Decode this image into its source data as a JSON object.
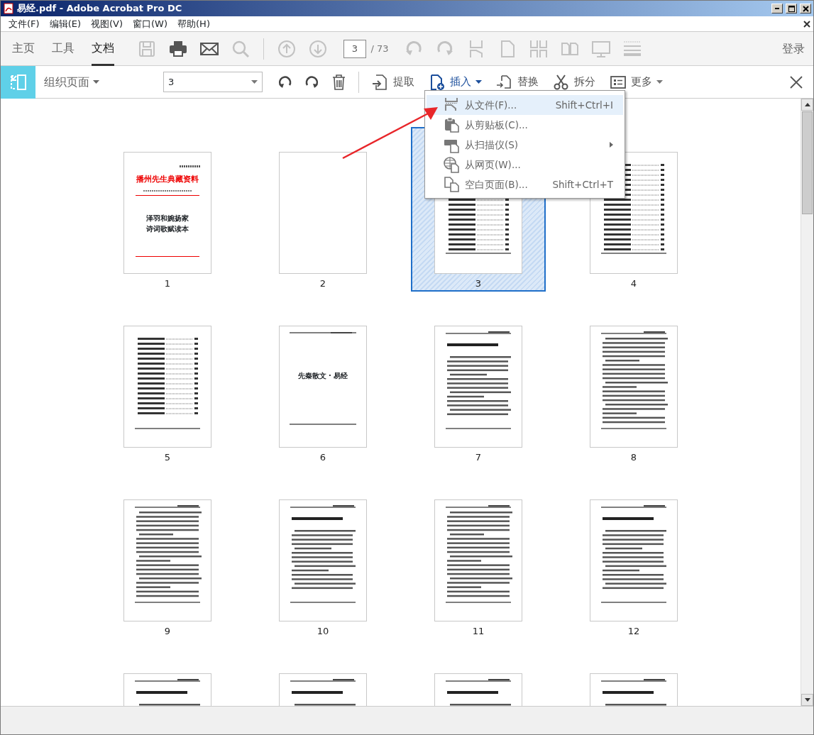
{
  "window": {
    "title": "易经.pdf - Adobe Acrobat Pro DC"
  },
  "menu_bar": [
    "文件(F)",
    "编辑(E)",
    "视图(V)",
    "窗口(W)",
    "帮助(H)"
  ],
  "nav_tabs": [
    {
      "label": "主页",
      "selected": false
    },
    {
      "label": "工具",
      "selected": false
    },
    {
      "label": "文档",
      "selected": true
    }
  ],
  "toolbar": {
    "tools": [
      {
        "kind": "save",
        "disabled": true
      },
      {
        "kind": "print",
        "disabled": false
      },
      {
        "kind": "mail",
        "disabled": false
      },
      {
        "kind": "search",
        "disabled": true
      },
      {
        "kind": "sep"
      },
      {
        "kind": "up",
        "disabled": true
      },
      {
        "kind": "down",
        "disabled": true
      },
      {
        "kind": "page"
      },
      {
        "kind": "undo",
        "disabled": true
      },
      {
        "kind": "redo",
        "disabled": true
      },
      {
        "kind": "crop",
        "disabled": true
      },
      {
        "kind": "doc",
        "disabled": true
      },
      {
        "kind": "cols",
        "disabled": true
      },
      {
        "kind": "book",
        "disabled": true
      },
      {
        "kind": "screen",
        "disabled": true
      },
      {
        "kind": "lines",
        "disabled": true
      }
    ],
    "page_number": "3",
    "page_total": "/ 73",
    "login": "登录"
  },
  "organize_bar": {
    "title": "组织页面",
    "page_range": "3",
    "actions": [
      {
        "kind": "extract",
        "label": "提取",
        "selected": false
      },
      {
        "kind": "insert",
        "label": "插入",
        "selected": true
      },
      {
        "kind": "replace",
        "label": "替换",
        "selected": false
      },
      {
        "kind": "split",
        "label": "拆分",
        "selected": false
      },
      {
        "kind": "more",
        "label": "更多",
        "selected": false
      }
    ]
  },
  "insert_menu": [
    {
      "kind": "file",
      "label": "从文件(F)...",
      "shortcut": "Shift+Ctrl+I",
      "selected": true,
      "submenu": false
    },
    {
      "kind": "clipboard",
      "label": "从剪贴板(C)...",
      "selected": false,
      "submenu": false
    },
    {
      "kind": "scanner",
      "label": "从扫描仪(S)",
      "selected": false,
      "submenu": true
    },
    {
      "kind": "web",
      "label": "从网页(W)...",
      "selected": false,
      "submenu": false
    },
    {
      "kind": "blank",
      "label": "空白页面(B)...",
      "shortcut": "Shift+Ctrl+T",
      "selected": false,
      "submenu": false
    }
  ],
  "pages": [
    {
      "kind": "cover",
      "label": "1",
      "selected": false,
      "title": "播州先生典藏资料",
      "lines": [
        "泽羽和婉扬家",
        "诗词歌赋读本"
      ]
    },
    {
      "kind": "blank",
      "label": "2",
      "selected": false
    },
    {
      "kind": "toc",
      "label": "3",
      "selected": true
    },
    {
      "kind": "toc",
      "label": "4",
      "selected": false
    },
    {
      "kind": "toc",
      "label": "5",
      "selected": false
    },
    {
      "kind": "section",
      "label": "6",
      "selected": false,
      "title": "先秦散文 · 易经"
    },
    {
      "kind": "chapter",
      "label": "7",
      "selected": false
    },
    {
      "kind": "text",
      "label": "8",
      "selected": false
    },
    {
      "kind": "text",
      "label": "9",
      "selected": false
    },
    {
      "kind": "chapter",
      "label": "10",
      "selected": false
    },
    {
      "kind": "text",
      "label": "11",
      "selected": false
    },
    {
      "kind": "chapter",
      "label": "12",
      "selected": false
    },
    {
      "kind": "chapter",
      "selected": false
    },
    {
      "kind": "chapter",
      "selected": false
    },
    {
      "kind": "chapter",
      "selected": false
    },
    {
      "kind": "chapter",
      "selected": false
    }
  ]
}
